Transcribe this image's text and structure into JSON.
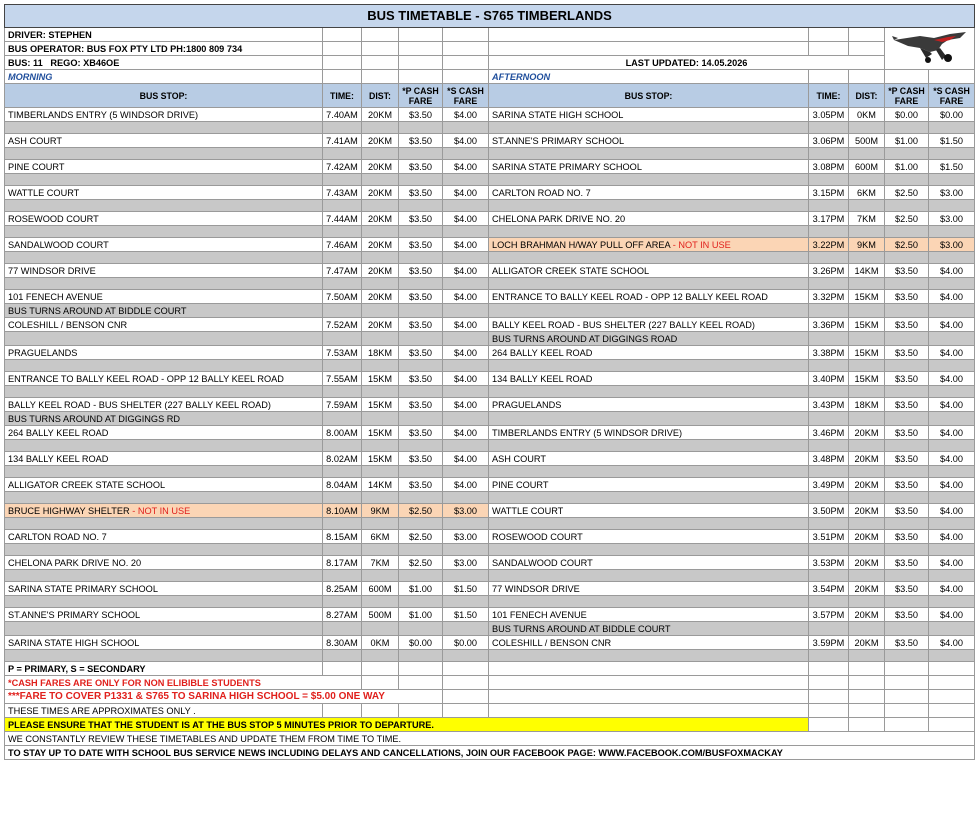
{
  "title": "BUS TIMETABLE - S765 TIMBERLANDS",
  "info": {
    "driver": "DRIVER: STEPHEN",
    "operator": "BUS OPERATOR: BUS FOX PTY LTD PH:1800 809 734",
    "bus": "BUS: 11",
    "rego": "REGO:  XB46OE",
    "updated": "LAST UPDATED: 14.05.2026"
  },
  "sections": {
    "morning": "MORNING",
    "afternoon": "AFTERNOON"
  },
  "headers": {
    "stop": "BUS STOP:",
    "time": "TIME:",
    "dist": "DIST:",
    "p_fare": "*P CASH FARE",
    "s_fare": "*S CASH FARE"
  },
  "morning": [
    {
      "stop": "TIMBERLANDS ENTRY (5 WINDSOR DRIVE)",
      "time": "7.40AM",
      "dist": "20KM",
      "p": "$3.50",
      "s": "$4.00"
    },
    {
      "stop": "ASH COURT",
      "time": "7.41AM",
      "dist": "20KM",
      "p": "$3.50",
      "s": "$4.00"
    },
    {
      "stop": "PINE COURT",
      "time": "7.42AM",
      "dist": "20KM",
      "p": "$3.50",
      "s": "$4.00"
    },
    {
      "stop": "WATTLE COURT",
      "time": "7.43AM",
      "dist": "20KM",
      "p": "$3.50",
      "s": "$4.00"
    },
    {
      "stop": "ROSEWOOD COURT",
      "time": "7.44AM",
      "dist": "20KM",
      "p": "$3.50",
      "s": "$4.00"
    },
    {
      "stop": "SANDALWOOD COURT",
      "time": "7.46AM",
      "dist": "20KM",
      "p": "$3.50",
      "s": "$4.00"
    },
    {
      "stop": "77 WINDSOR DRIVE",
      "time": "7.47AM",
      "dist": "20KM",
      "p": "$3.50",
      "s": "$4.00"
    },
    {
      "stop": "101 FENECH AVENUE",
      "time": "7.50AM",
      "dist": "20KM",
      "p": "$3.50",
      "s": "$4.00"
    },
    {
      "stop": "COLESHILL / BENSON CNR",
      "time": "7.52AM",
      "dist": "20KM",
      "p": "$3.50",
      "s": "$4.00"
    },
    {
      "stop": "PRAGUELANDS",
      "time": "7.53AM",
      "dist": "18KM",
      "p": "$3.50",
      "s": "$4.00"
    },
    {
      "stop": "ENTRANCE TO BALLY KEEL ROAD - OPP 12 BALLY KEEL ROAD",
      "time": "7.55AM",
      "dist": "15KM",
      "p": "$3.50",
      "s": "$4.00"
    },
    {
      "stop": "BALLY KEEL ROAD - BUS SHELTER (227 BALLY KEEL ROAD)",
      "time": "7.59AM",
      "dist": "15KM",
      "p": "$3.50",
      "s": "$4.00"
    },
    {
      "stop": "264 BALLY KEEL ROAD",
      "time": "8.00AM",
      "dist": "15KM",
      "p": "$3.50",
      "s": "$4.00"
    },
    {
      "stop": "134 BALLY KEEL ROAD",
      "time": "8.02AM",
      "dist": "15KM",
      "p": "$3.50",
      "s": "$4.00"
    },
    {
      "stop": "ALLIGATOR CREEK STATE SCHOOL",
      "time": "8.04AM",
      "dist": "14KM",
      "p": "$3.50",
      "s": "$4.00"
    },
    {
      "stop": "BRUCE HIGHWAY SHELTER",
      "tag": " - NOT IN USE",
      "time": "8.10AM",
      "dist": "9KM",
      "p": "$2.50",
      "s": "$3.00"
    },
    {
      "stop": "CARLTON ROAD NO. 7",
      "time": "8.15AM",
      "dist": "6KM",
      "p": "$2.50",
      "s": "$3.00"
    },
    {
      "stop": "CHELONA PARK DRIVE NO. 20",
      "time": "8.17AM",
      "dist": "7KM",
      "p": "$2.50",
      "s": "$3.00"
    },
    {
      "stop": "SARINA STATE PRIMARY SCHOOL",
      "time": "8.25AM",
      "dist": "600M",
      "p": "$1.00",
      "s": "$1.50"
    },
    {
      "stop": "ST.ANNE'S PRIMARY SCHOOL",
      "time": "8.27AM",
      "dist": "500M",
      "p": "$1.00",
      "s": "$1.50"
    },
    {
      "stop": "SARINA STATE HIGH SCHOOL",
      "time": "8.30AM",
      "dist": "0KM",
      "p": "$0.00",
      "s": "$0.00"
    }
  ],
  "afternoon": [
    {
      "stop": "SARINA STATE HIGH SCHOOL",
      "time": "3.05PM",
      "dist": "0KM",
      "p": "$0.00",
      "s": "$0.00"
    },
    {
      "stop": "ST.ANNE'S PRIMARY SCHOOL",
      "time": "3.06PM",
      "dist": "500M",
      "p": "$1.00",
      "s": "$1.50"
    },
    {
      "stop": "SARINA STATE PRIMARY SCHOOL",
      "time": "3.08PM",
      "dist": "600M",
      "p": "$1.00",
      "s": "$1.50"
    },
    {
      "stop": "CARLTON ROAD NO. 7",
      "time": "3.15PM",
      "dist": "6KM",
      "p": "$2.50",
      "s": "$3.00"
    },
    {
      "stop": "CHELONA PARK DRIVE NO. 20",
      "time": "3.17PM",
      "dist": "7KM",
      "p": "$2.50",
      "s": "$3.00"
    },
    {
      "stop": "LOCH BRAHMAN H/WAY PULL OFF AREA",
      "tag": " - NOT IN USE",
      "time": "3.22PM",
      "dist": "9KM",
      "p": "$2.50",
      "s": "$3.00"
    },
    {
      "stop": "ALLIGATOR CREEK STATE SCHOOL",
      "time": "3.26PM",
      "dist": "14KM",
      "p": "$3.50",
      "s": "$4.00"
    },
    {
      "stop": "ENTRANCE TO BALLY KEEL ROAD - OPP 12 BALLY KEEL ROAD",
      "time": "3.32PM",
      "dist": "15KM",
      "p": "$3.50",
      "s": "$4.00"
    },
    {
      "stop": "BALLY KEEL ROAD - BUS SHELTER (227 BALLY KEEL ROAD)",
      "time": "3.36PM",
      "dist": "15KM",
      "p": "$3.50",
      "s": "$4.00"
    },
    {
      "stop": "264 BALLY KEEL ROAD",
      "time": "3.38PM",
      "dist": "15KM",
      "p": "$3.50",
      "s": "$4.00"
    },
    {
      "stop": "134 BALLY KEEL ROAD",
      "time": "3.40PM",
      "dist": "15KM",
      "p": "$3.50",
      "s": "$4.00"
    },
    {
      "stop": "PRAGUELANDS",
      "time": "3.43PM",
      "dist": "18KM",
      "p": "$3.50",
      "s": "$4.00"
    },
    {
      "stop": "TIMBERLANDS ENTRY (5 WINDSOR DRIVE)",
      "time": "3.46PM",
      "dist": "20KM",
      "p": "$3.50",
      "s": "$4.00"
    },
    {
      "stop": "ASH COURT",
      "time": "3.48PM",
      "dist": "20KM",
      "p": "$3.50",
      "s": "$4.00"
    },
    {
      "stop": "PINE COURT",
      "time": "3.49PM",
      "dist": "20KM",
      "p": "$3.50",
      "s": "$4.00"
    },
    {
      "stop": "WATTLE COURT",
      "time": "3.50PM",
      "dist": "20KM",
      "p": "$3.50",
      "s": "$4.00"
    },
    {
      "stop": "ROSEWOOD COURT",
      "time": "3.51PM",
      "dist": "20KM",
      "p": "$3.50",
      "s": "$4.00"
    },
    {
      "stop": "SANDALWOOD COURT",
      "time": "3.53PM",
      "dist": "20KM",
      "p": "$3.50",
      "s": "$4.00"
    },
    {
      "stop": "77 WINDSOR DRIVE",
      "time": "3.54PM",
      "dist": "20KM",
      "p": "$3.50",
      "s": "$4.00"
    },
    {
      "stop": "101 FENECH AVENUE",
      "time": "3.57PM",
      "dist": "20KM",
      "p": "$3.50",
      "s": "$4.00"
    },
    {
      "stop": "COLESHILL / BENSON CNR",
      "time": "3.59PM",
      "dist": "20KM",
      "p": "$3.50",
      "s": "$4.00"
    }
  ],
  "turnarounds": {
    "biddle": "BUS TURNS AROUND AT BIDDLE COURT",
    "diggings_rd": "BUS TURNS AROUND AT DIGGINGS RD",
    "diggings_road": "BUS TURNS AROUND AT DIGGINGS ROAD"
  },
  "notes": {
    "legend": "P = PRIMARY, S = SECONDARY",
    "cash": "*CASH FARES ARE ONLY FOR NON ELIBIBLE STUDENTS",
    "fare": "***FARE TO COVER P1331 & S765 TO SARINA HIGH SCHOOL = $5.00 ONE WAY",
    "approx": "THESE TIMES ARE APPROXIMATES ONLY .",
    "ensure": "PLEASE ENSURE THAT THE STUDENT IS AT THE BUS STOP 5 MINUTES PRIOR TO DEPARTURE.",
    "review": "WE CONSTANTLY REVIEW THESE TIMETABLES AND UPDATE THEM FROM TIME TO TIME.",
    "facebook": "TO STAY UP TO DATE WITH SCHOOL BUS SERVICE NEWS INCLUDING DELAYS AND CANCELLATIONS, JOIN OUR FACEBOOK PAGE: WWW.FACEBOOK.COM/BUSFOXMACKAY"
  },
  "logo_icon": "fox-bus-logo",
  "colors": {
    "title_bg": "#c5d6ec",
    "header_bg": "#b8cce4",
    "gap_bg": "#c8c8c8",
    "highlight": "#fbd5b5",
    "warning": "#e0201c",
    "notice": "#ffff00"
  }
}
